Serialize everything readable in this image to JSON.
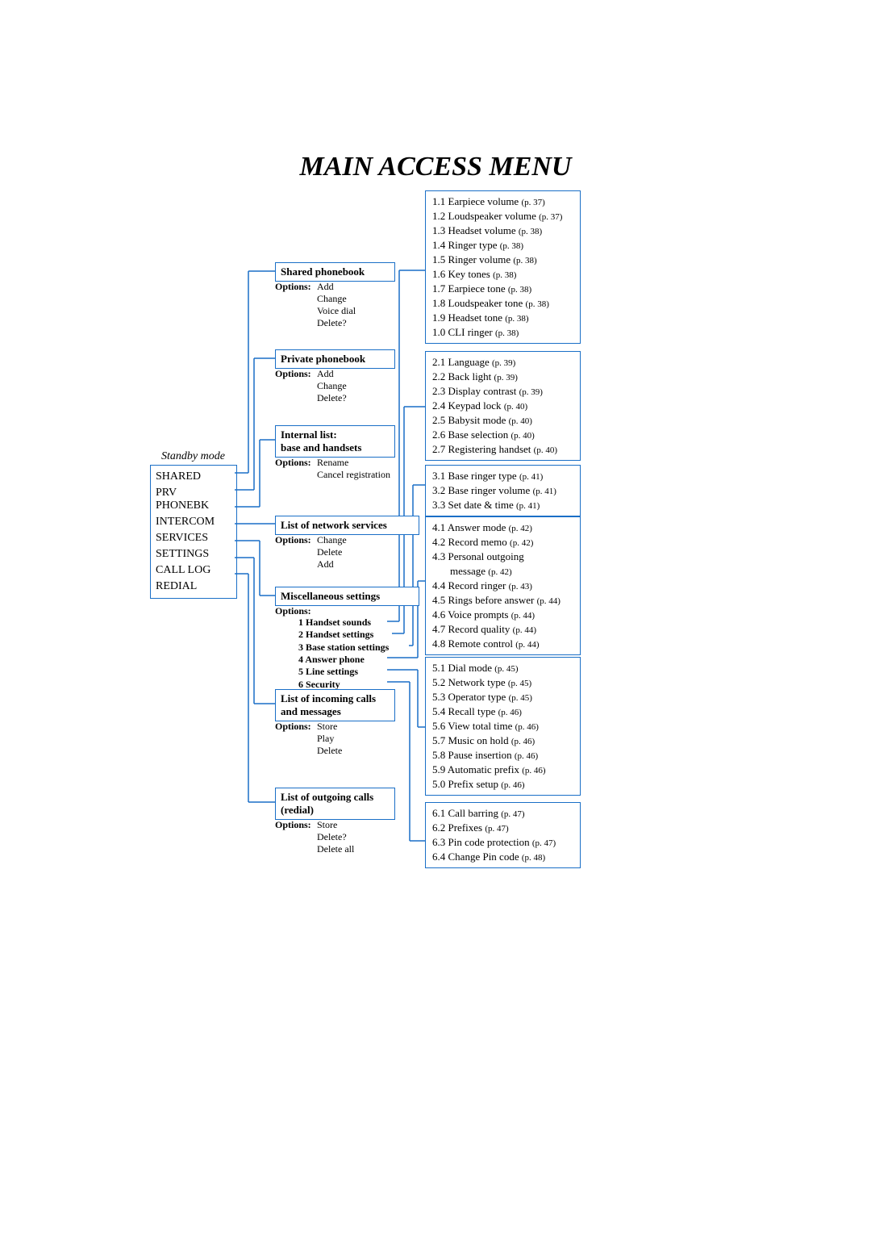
{
  "title": "MAIN ACCESS MENU",
  "standby_label": "Standby mode",
  "left_items": [
    "SHARED",
    "PRV PHONEBK",
    "INTERCOM",
    "SERVICES",
    "SETTINGS",
    "CALL LOG",
    "REDIAL"
  ],
  "options_label": "Options:",
  "mid": {
    "shared": {
      "title": "Shared phonebook",
      "opts": [
        "Add",
        "Change",
        "Voice dial",
        "Delete?"
      ]
    },
    "private": {
      "title": "Private phonebook",
      "opts": [
        "Add",
        "Change",
        "Delete?"
      ]
    },
    "internal": {
      "title_l1": "Internal list:",
      "title_l2": "base and handsets",
      "opts": [
        "Rename",
        "Cancel registration"
      ]
    },
    "services": {
      "title": "List of network services",
      "opts": [
        "Change",
        "Delete",
        "Add"
      ]
    },
    "misc": {
      "title": "Miscellaneous settings",
      "opts": [
        "1 Handset sounds",
        "2 Handset settings",
        "3 Base station settings",
        "4 Answer phone",
        "5 Line settings",
        "6 Security"
      ]
    },
    "incoming": {
      "title_l1": "List of incoming calls",
      "title_l2": "and messages",
      "opts": [
        "Store",
        "Play",
        "Delete"
      ]
    },
    "outgoing": {
      "title_l1": "List of outgoing calls",
      "title_l2": "(redial)",
      "opts": [
        "Store",
        "Delete?",
        "Delete all"
      ]
    }
  },
  "right": {
    "r1": [
      {
        "n": "1.1",
        "t": "Earpiece volume",
        "p": "(p. 37)"
      },
      {
        "n": "1.2",
        "t": "Loudspeaker volume",
        "p": "(p. 37)"
      },
      {
        "n": "1.3",
        "t": "Headset volume",
        "p": "(p. 38)"
      },
      {
        "n": "1.4",
        "t": "Ringer type",
        "p": "(p. 38)"
      },
      {
        "n": "1.5",
        "t": "Ringer volume",
        "p": "(p. 38)"
      },
      {
        "n": "1.6",
        "t": "Key tones",
        "p": "(p. 38)"
      },
      {
        "n": "1.7",
        "t": "Earpiece tone",
        "p": "(p. 38)"
      },
      {
        "n": "1.8",
        "t": "Loudspeaker tone",
        "p": "(p. 38)"
      },
      {
        "n": "1.9",
        "t": "Headset tone",
        "p": "(p. 38)"
      },
      {
        "n": "1.0",
        "t": "CLI ringer",
        "p": "(p. 38)"
      }
    ],
    "r2": [
      {
        "n": "2.1",
        "t": "Language",
        "p": "(p. 39)"
      },
      {
        "n": "2.2",
        "t": "Back light",
        "p": "(p. 39)"
      },
      {
        "n": "2.3",
        "t": "Display contrast",
        "p": "(p. 39)"
      },
      {
        "n": "2.4",
        "t": "Keypad lock",
        "p": "(p. 40)"
      },
      {
        "n": "2.5",
        "t": "Babysit mode",
        "p": "(p. 40)"
      },
      {
        "n": "2.6",
        "t": "Base selection",
        "p": "(p. 40)"
      },
      {
        "n": "2.7",
        "t": "Registering handset",
        "p": "(p. 40)"
      }
    ],
    "r3": [
      {
        "n": "3.1",
        "t": "Base ringer type",
        "p": "(p. 41)"
      },
      {
        "n": "3.2",
        "t": "Base ringer volume",
        "p": "(p. 41)"
      },
      {
        "n": "3.3",
        "t": "Set date & time",
        "p": "(p. 41)"
      }
    ],
    "r4": [
      {
        "n": "4.1",
        "t": "Answer mode",
        "p": "(p. 42)"
      },
      {
        "n": "4.2",
        "t": "Record memo",
        "p": "(p. 42)"
      },
      {
        "n": "4.3",
        "t": "Personal outgoing",
        "p": ""
      },
      {
        "sub": true,
        "n": "",
        "t": "message",
        "p": "(p. 42)"
      },
      {
        "n": "4.4",
        "t": "Record ringer",
        "p": "(p. 43)"
      },
      {
        "n": "4.5",
        "t": "Rings before answer",
        "p": "(p. 44)"
      },
      {
        "n": "4.6",
        "t": "Voice prompts",
        "p": "(p. 44)"
      },
      {
        "n": "4.7",
        "t": "Record quality",
        "p": "(p. 44)"
      },
      {
        "n": "4.8",
        "t": "Remote control",
        "p": "(p. 44)"
      }
    ],
    "r5": [
      {
        "n": "5.1",
        "t": "Dial mode",
        "p": "(p. 45)"
      },
      {
        "n": "5.2",
        "t": "Network type",
        "p": "(p. 45)"
      },
      {
        "n": "5.3",
        "t": "Operator type",
        "p": "(p. 45)"
      },
      {
        "n": "5.4",
        "t": "Recall type",
        "p": "(p. 46)"
      },
      {
        "n": "5.6",
        "t": "View total time",
        "p": "(p. 46)"
      },
      {
        "n": "5.7",
        "t": "Music on hold",
        "p": "(p. 46)"
      },
      {
        "n": "5.8",
        "t": "Pause insertion",
        "p": "(p. 46)"
      },
      {
        "n": "5.9",
        "t": "Automatic prefix",
        "p": "(p. 46)"
      },
      {
        "n": "5.0",
        "t": "Prefix setup",
        "p": "(p. 46)"
      }
    ],
    "r6": [
      {
        "n": "6.1",
        "t": "Call barring",
        "p": "(p. 47)"
      },
      {
        "n": "6.2",
        "t": "Prefixes",
        "p": "(p. 47)"
      },
      {
        "n": "6.3",
        "t": "Pin code protection",
        "p": "(p. 47)"
      },
      {
        "n": "6.4",
        "t": "Change Pin code",
        "p": "(p. 48)"
      }
    ]
  }
}
